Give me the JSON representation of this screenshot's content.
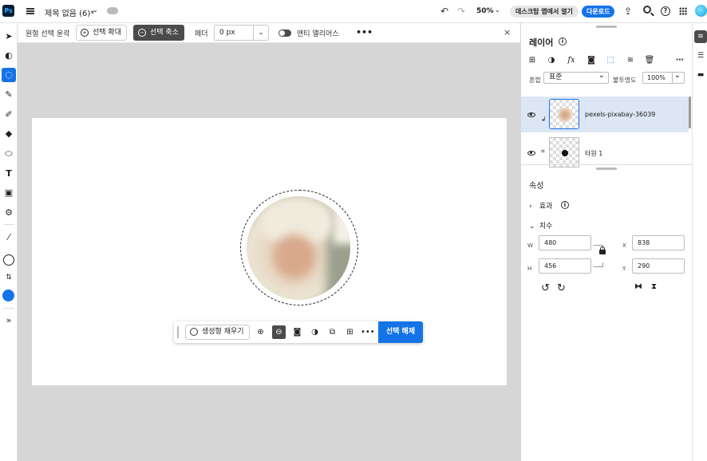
{
  "app": {
    "logo": "Ps",
    "doc_title": "제목 없음 (6)*"
  },
  "topbar": {
    "zoom": "50%",
    "open_desktop_label": "데스크탑 앱에서 열기",
    "download_label": "다운로드"
  },
  "options": {
    "tool_name": "원형 선택 윤곽",
    "expand_label": "선택 확대",
    "contract_label": "선택 축소",
    "feather_label": "페더",
    "feather_value": "0 px",
    "antialias_label": "앤티 앨리어스",
    "more": "•••",
    "close": "×"
  },
  "taskbar": {
    "gen_fill_label": "생성형 채우기",
    "deselect_label": "선택 해제",
    "more": "•••"
  },
  "layers": {
    "title": "레이어",
    "blend_label": "혼합",
    "blend_value": "표준",
    "opacity_label": "불투명도",
    "opacity_value": "100%",
    "items": [
      {
        "name": "pexels-pixabay-36039",
        "selected": true
      },
      {
        "name": "타원 1",
        "selected": false
      }
    ]
  },
  "properties": {
    "title": "속성",
    "effects_label": "효과",
    "dimensions_label": "치수",
    "w_label": "W",
    "w_value": "480",
    "h_label": "H",
    "h_value": "456",
    "x_label": "X",
    "x_value": "838",
    "y_label": "Y",
    "y_value": "290"
  },
  "colors": {
    "accent": "#1473e6",
    "dark_button": "#4b4b4b",
    "canvas_bg": "#d6d6d6"
  }
}
